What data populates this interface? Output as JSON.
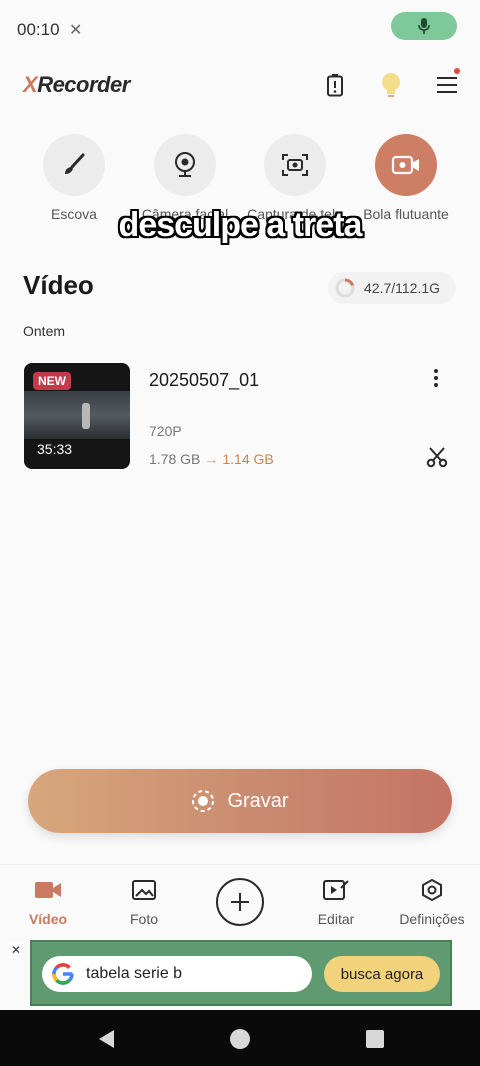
{
  "status": {
    "time": "00:10",
    "extra_icon": "x"
  },
  "header": {
    "logo_x": "X",
    "logo_rest": "Recorder"
  },
  "tools": [
    {
      "label": "Escova",
      "icon": "brush-icon"
    },
    {
      "label": "Câmera facial",
      "icon": "webcam-icon"
    },
    {
      "label": "Captura de tela",
      "icon": "screenshot-icon"
    },
    {
      "label": "Bola flutuante",
      "icon": "floating-ball-icon"
    }
  ],
  "overlay_caption": "desculpe a treta",
  "video_section": {
    "title": "Vídeo",
    "storage": "42.7/112.1G",
    "group_label": "Ontem",
    "items": [
      {
        "badge": "NEW",
        "duration": "35:33",
        "name": "20250507_01",
        "resolution": "720P",
        "size_from": "1.78 GB",
        "arrow": "→",
        "size_to": "1.14 GB"
      }
    ]
  },
  "record_button": {
    "label": "Gravar"
  },
  "bottom_nav": [
    {
      "label": "Vídeo",
      "active": true
    },
    {
      "label": "Foto",
      "active": false
    },
    {
      "label": "Editar",
      "active": false
    },
    {
      "label": "Definições",
      "active": false
    }
  ],
  "ad": {
    "close": "✕",
    "query": "tabela serie b",
    "cta": "busca agora"
  },
  "colors": {
    "accent": "#c97a60",
    "record_start": "#d8a77c",
    "record_end": "#c47466",
    "ad_bg": "#5f9a70"
  }
}
